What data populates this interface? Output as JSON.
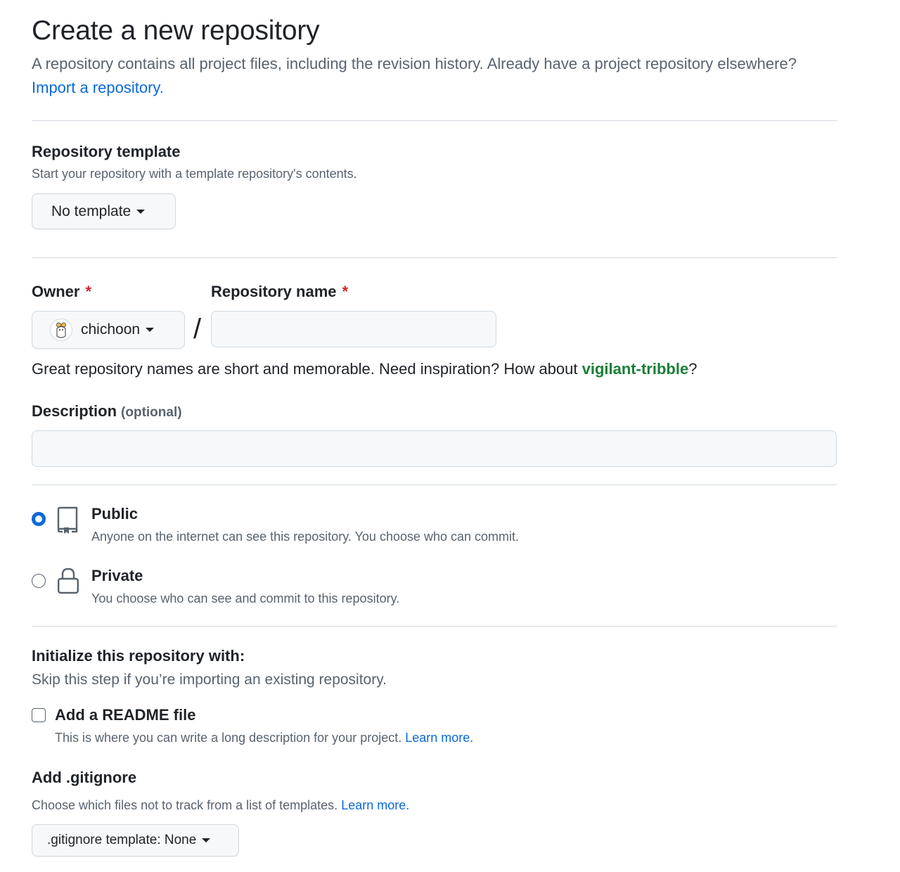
{
  "header": {
    "title": "Create a new repository",
    "subtitle_text": "A repository contains all project files, including the revision history. Already have a project repository elsewhere?",
    "import_link": "Import a repository."
  },
  "template": {
    "title": "Repository template",
    "description": "Start your repository with a template repository's contents.",
    "button_label": "No template"
  },
  "owner": {
    "label": "Owner",
    "required_mark": "*",
    "value": "chichoon",
    "avatar_icon": "octocat-avatar-icon"
  },
  "repo_name": {
    "label": "Repository name",
    "required_mark": "*",
    "separator": "/",
    "value": "",
    "hint_prefix": "Great repository names are short and memorable. Need inspiration? How about ",
    "suggestion": "vigilant-tribble",
    "hint_suffix": "?"
  },
  "description": {
    "label": "Description",
    "optional": "(optional)",
    "value": ""
  },
  "visibility": {
    "selected": "public",
    "options": [
      {
        "id": "public",
        "label": "Public",
        "description": "Anyone on the internet can see this repository. You choose who can commit.",
        "icon": "repo-icon"
      },
      {
        "id": "private",
        "label": "Private",
        "description": "You choose who can see and commit to this repository.",
        "icon": "lock-icon"
      }
    ]
  },
  "initialize": {
    "title": "Initialize this repository with:",
    "description": "Skip this step if you’re importing an existing repository.",
    "readme": {
      "label": "Add a README file",
      "checked": false,
      "description": "This is where you can write a long description for your project.",
      "learn_more": "Learn more."
    }
  },
  "gitignore": {
    "title": "Add .gitignore",
    "description": "Choose which files not to track from a list of templates.",
    "learn_more": "Learn more.",
    "button_label": ".gitignore template: None"
  },
  "colors": {
    "link": "#0969da",
    "suggestion": "#1a7f37",
    "required": "#d1242f",
    "muted": "#59636e",
    "border": "#d1d9e0"
  }
}
